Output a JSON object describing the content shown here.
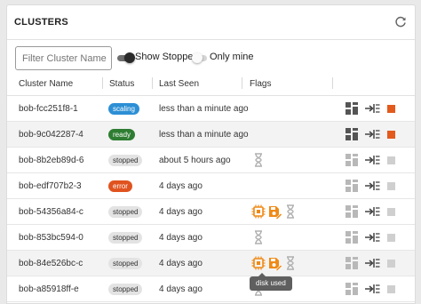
{
  "header": {
    "title": "CLUSTERS",
    "refresh_icon": "refresh-icon"
  },
  "filter": {
    "placeholder": "Filter Cluster Name",
    "value": "Filter Cluster Name"
  },
  "toggles": {
    "show_stopped": {
      "label": "Show Stopped",
      "on": true
    },
    "only_mine": {
      "label": "Only mine",
      "on": false
    }
  },
  "columns": {
    "name": "Cluster Name",
    "status": "Status",
    "last_seen": "Last Seen",
    "flags": "Flags"
  },
  "colors": {
    "scaling": "#2d8fd5",
    "ready": "#2e7d32",
    "error": "#e0531f",
    "stopped": "#e3e3e3",
    "flag_active": "#ef8a17",
    "flag_idle": "#b0b0b0",
    "stop_active": "#e35a1d",
    "stop_idle": "#cfcfcf",
    "icon_active": "#555555",
    "icon_idle": "#b8b8b8"
  },
  "rows": [
    {
      "name": "bob-fcc251f8-1",
      "status": "scaling",
      "last_seen": "less than a minute ago",
      "flags": [],
      "active": true,
      "highlight": false
    },
    {
      "name": "bob-9c042287-4",
      "status": "ready",
      "last_seen": "less than a minute ago",
      "flags": [],
      "active": true,
      "highlight": true
    },
    {
      "name": "bob-8b2eb89d-6",
      "status": "stopped",
      "last_seen": "about 5 hours ago",
      "flags": [
        "hourglass-icon"
      ],
      "active": false,
      "highlight": false
    },
    {
      "name": "bob-edf707b2-3",
      "status": "error",
      "last_seen": "4 days ago",
      "flags": [],
      "active": false,
      "highlight": false
    },
    {
      "name": "bob-54356a84-c",
      "status": "stopped",
      "last_seen": "4 days ago",
      "flags": [
        "cpu-icon",
        "disk-edit-icon",
        "hourglass-icon"
      ],
      "active": false,
      "highlight": false
    },
    {
      "name": "bob-853bc594-0",
      "status": "stopped",
      "last_seen": "4 days ago",
      "flags": [
        "hourglass-icon"
      ],
      "active": false,
      "highlight": false
    },
    {
      "name": "bob-84e526bc-c",
      "status": "stopped",
      "last_seen": "4 days ago",
      "flags": [
        "cpu-icon",
        "disk-edit-icon",
        "hourglass-icon"
      ],
      "active": false,
      "highlight": true
    },
    {
      "name": "bob-a85918ff-e",
      "status": "stopped",
      "last_seen": "4 days ago",
      "flags": [
        "hourglass-icon"
      ],
      "active": false,
      "highlight": false
    }
  ],
  "tooltip": {
    "text": "disk used"
  }
}
